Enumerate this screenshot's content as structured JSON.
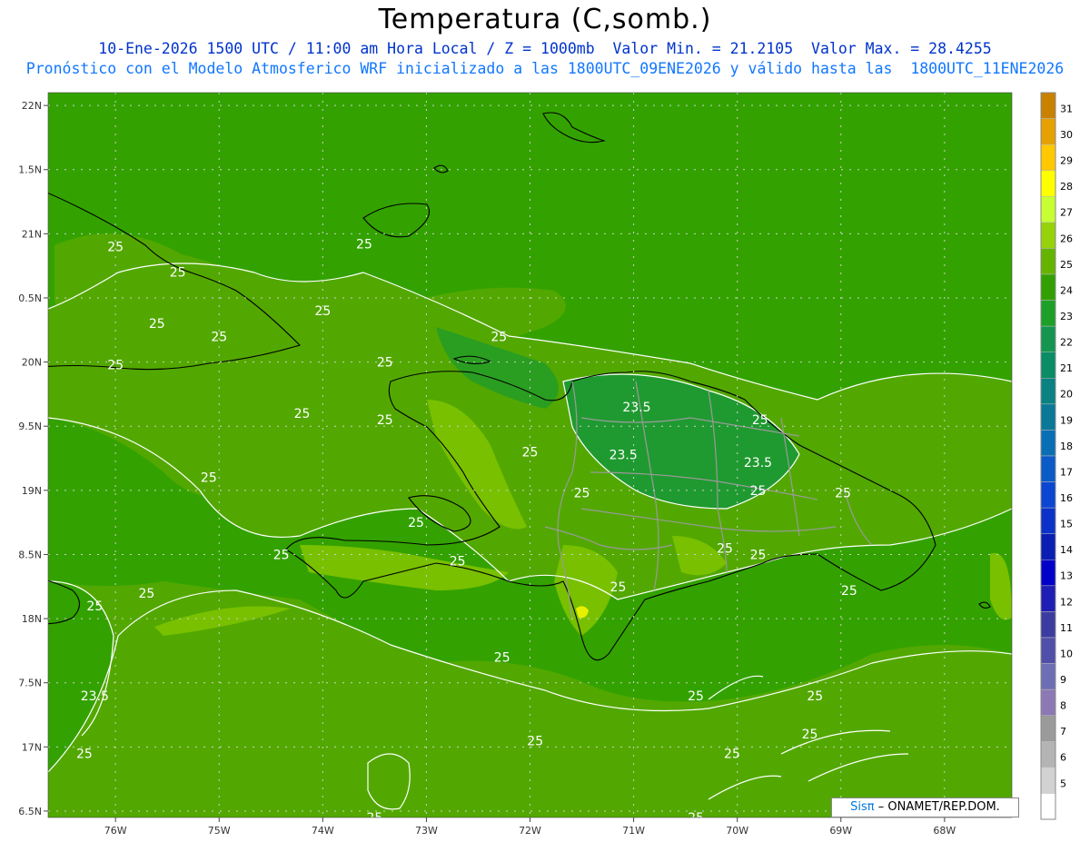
{
  "title": "Temperatura (C,somb.)",
  "subtitle_line1": "10-Ene-2026 1500 UTC / 11:00 am Hora Local / Z = 1000mb  Valor Min. = 21.2105  Valor Max. = 28.4255",
  "subtitle_line2": "Pronóstico con el Modelo Atmosferico WRF inicializado a las 1800UTC_09ENE2026 y válido hasta las  1800UTC_11ENE2026",
  "credit": {
    "brand": "Sisπ",
    "text": "– ONAMET/REP.DOM."
  },
  "map": {
    "lon_range": [
      -76.65,
      -67.35
    ],
    "lat_range": [
      16.45,
      22.1
    ],
    "x_ticks": [
      {
        "lon": -76,
        "label": "76W"
      },
      {
        "lon": -75,
        "label": "75W"
      },
      {
        "lon": -74,
        "label": "74W"
      },
      {
        "lon": -73,
        "label": "73W"
      },
      {
        "lon": -72,
        "label": "72W"
      },
      {
        "lon": -71,
        "label": "71W"
      },
      {
        "lon": -70,
        "label": "70W"
      },
      {
        "lon": -69,
        "label": "69W"
      },
      {
        "lon": -68,
        "label": "68W"
      }
    ],
    "y_ticks": [
      {
        "lat": 22.0,
        "label": "22N"
      },
      {
        "lat": 21.5,
        "label": "1.5N"
      },
      {
        "lat": 21.0,
        "label": "21N"
      },
      {
        "lat": 20.5,
        "label": "0.5N"
      },
      {
        "lat": 20.0,
        "label": "20N"
      },
      {
        "lat": 19.5,
        "label": "9.5N"
      },
      {
        "lat": 19.0,
        "label": "19N"
      },
      {
        "lat": 18.5,
        "label": "8.5N"
      },
      {
        "lat": 18.0,
        "label": "18N"
      },
      {
        "lat": 17.5,
        "label": "7.5N"
      },
      {
        "lat": 17.0,
        "label": "17N"
      },
      {
        "lat": 16.5,
        "label": "6.5N"
      }
    ],
    "background_color": "#52a800",
    "contour_labels": [
      {
        "lon": -76.0,
        "lat": 20.9,
        "text": "25"
      },
      {
        "lon": -75.4,
        "lat": 20.7,
        "text": "25"
      },
      {
        "lon": -75.6,
        "lat": 20.3,
        "text": "25"
      },
      {
        "lon": -75.0,
        "lat": 20.2,
        "text": "25"
      },
      {
        "lon": -76.0,
        "lat": 19.98,
        "text": "25"
      },
      {
        "lon": -74.0,
        "lat": 20.4,
        "text": "25"
      },
      {
        "lon": -73.4,
        "lat": 20.0,
        "text": "25"
      },
      {
        "lon": -72.3,
        "lat": 20.2,
        "text": "25"
      },
      {
        "lon": -73.6,
        "lat": 20.92,
        "text": "25"
      },
      {
        "lon": -74.2,
        "lat": 19.6,
        "text": "25"
      },
      {
        "lon": -75.1,
        "lat": 19.1,
        "text": "25"
      },
      {
        "lon": -73.4,
        "lat": 19.55,
        "text": "25"
      },
      {
        "lon": -73.1,
        "lat": 18.75,
        "text": "25"
      },
      {
        "lon": -72.0,
        "lat": 19.3,
        "text": "25"
      },
      {
        "lon": -71.5,
        "lat": 18.98,
        "text": "25"
      },
      {
        "lon": -72.7,
        "lat": 18.45,
        "text": "25"
      },
      {
        "lon": -74.4,
        "lat": 18.5,
        "text": "25"
      },
      {
        "lon": -75.7,
        "lat": 18.2,
        "text": "25"
      },
      {
        "lon": -76.2,
        "lat": 18.1,
        "text": "25"
      },
      {
        "lon": -70.97,
        "lat": 19.65,
        "text": "23.5"
      },
      {
        "lon": -71.1,
        "lat": 19.28,
        "text": "23.5"
      },
      {
        "lon": -69.8,
        "lat": 19.22,
        "text": "23.5"
      },
      {
        "lon": -69.78,
        "lat": 19.55,
        "text": "25"
      },
      {
        "lon": -69.8,
        "lat": 19.0,
        "text": "25"
      },
      {
        "lon": -68.98,
        "lat": 18.98,
        "text": "25"
      },
      {
        "lon": -70.12,
        "lat": 18.55,
        "text": "25"
      },
      {
        "lon": -69.8,
        "lat": 18.5,
        "text": "25"
      },
      {
        "lon": -71.15,
        "lat": 18.25,
        "text": "25"
      },
      {
        "lon": -68.92,
        "lat": 18.22,
        "text": "25"
      },
      {
        "lon": -72.27,
        "lat": 17.7,
        "text": "25"
      },
      {
        "lon": -76.2,
        "lat": 17.4,
        "text": "23.5"
      },
      {
        "lon": -76.3,
        "lat": 16.95,
        "text": "25"
      },
      {
        "lon": -71.95,
        "lat": 17.05,
        "text": "25"
      },
      {
        "lon": -70.4,
        "lat": 17.4,
        "text": "25"
      },
      {
        "lon": -69.25,
        "lat": 17.4,
        "text": "25"
      },
      {
        "lon": -69.3,
        "lat": 17.1,
        "text": "25"
      },
      {
        "lon": -70.05,
        "lat": 16.95,
        "text": "25"
      },
      {
        "lon": -73.5,
        "lat": 16.45,
        "text": "25"
      },
      {
        "lon": -70.4,
        "lat": 16.45,
        "text": "25"
      }
    ]
  },
  "colorbar": {
    "levels": [
      {
        "label": "31",
        "color": "#c88200"
      },
      {
        "label": "30",
        "color": "#e6a000"
      },
      {
        "label": "29",
        "color": "#ffc800"
      },
      {
        "label": "28",
        "color": "#ffff00"
      },
      {
        "label": "27",
        "color": "#c8ff32"
      },
      {
        "label": "26",
        "color": "#96d20a"
      },
      {
        "label": "25",
        "color": "#64b400"
      },
      {
        "label": "24",
        "color": "#32a000"
      },
      {
        "label": "23",
        "color": "#1ea028"
      },
      {
        "label": "22",
        "color": "#149650"
      },
      {
        "label": "21",
        "color": "#0a8c64"
      },
      {
        "label": "20",
        "color": "#0a8282"
      },
      {
        "label": "19",
        "color": "#0a7896"
      },
      {
        "label": "18",
        "color": "#0a6eb4"
      },
      {
        "label": "17",
        "color": "#0a5ac8"
      },
      {
        "label": "16",
        "color": "#0a46d2"
      },
      {
        "label": "15",
        "color": "#0a32c8"
      },
      {
        "label": "14",
        "color": "#0a1eb4"
      },
      {
        "label": "13",
        "color": "#0000c8"
      },
      {
        "label": "12",
        "color": "#1e1eb4"
      },
      {
        "label": "11",
        "color": "#3c3ca0"
      },
      {
        "label": "10",
        "color": "#5050aa"
      },
      {
        "label": "9",
        "color": "#6e6eb4"
      },
      {
        "label": "8",
        "color": "#8c78b4"
      },
      {
        "label": "7",
        "color": "#9a9a9a"
      },
      {
        "label": "6",
        "color": "#b4b4b4"
      },
      {
        "label": "5",
        "color": "#d2d2d2"
      },
      {
        "label": "",
        "color": "#ffffff"
      }
    ]
  }
}
